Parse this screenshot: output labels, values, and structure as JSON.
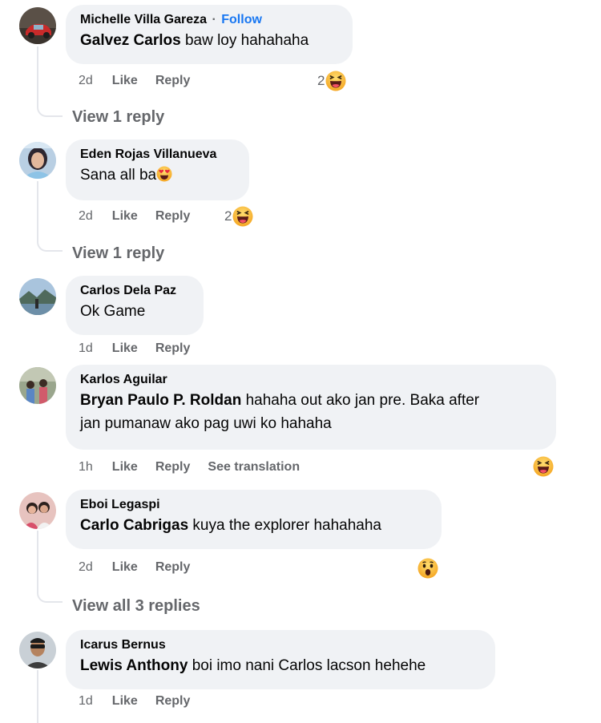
{
  "comments": [
    {
      "author": "Michelle Villa Gareza",
      "follow_label": "Follow",
      "separator": "·",
      "mention": "Galvez Carlos",
      "text": " baw loy hahahaha",
      "time": "2d",
      "like": "Like",
      "reply": "Reply",
      "reaction_count": "2",
      "reaction_icon": "laughing-emoji-icon",
      "view_replies": "View 1 reply"
    },
    {
      "author": "Eden Rojas Villanueva",
      "text": "Sana all ba",
      "inline_emoji": "heart-eyes-emoji-icon",
      "time": "2d",
      "like": "Like",
      "reply": "Reply",
      "reaction_count": "2",
      "reaction_icon": "laughing-emoji-icon",
      "view_replies": "View 1 reply"
    },
    {
      "author": "Carlos Dela Paz",
      "text": "Ok Game",
      "time": "1d",
      "like": "Like",
      "reply": "Reply"
    },
    {
      "author": "Karlos Aguilar",
      "mention": "Bryan Paulo P. Roldan",
      "text_line1": " hahaha out ako jan pre. Baka after",
      "text_line2": "jan pumanaw ako pag uwi ko hahaha",
      "time": "1h",
      "like": "Like",
      "reply": "Reply",
      "see_translation": "See translation",
      "reaction_icon": "laughing-emoji-icon"
    },
    {
      "author": "Eboi Legaspi",
      "mention": "Carlo Cabrigas",
      "text": " kuya the explorer hahahaha",
      "time": "2d",
      "like": "Like",
      "reply": "Reply",
      "reaction_icon": "wow-emoji-icon",
      "view_replies": "View all 3 replies"
    },
    {
      "author": "Icarus Bernus",
      "mention": "Lewis Anthony",
      "text": " boi imo nani Carlos lacson hehehe",
      "time": "1d",
      "like": "Like",
      "reply": "Reply"
    }
  ],
  "colors": {
    "bubble": "#f0f2f5",
    "secondary_text": "#65676b",
    "link_blue": "#1877f2",
    "thread_line": "#e4e6eb",
    "emoji_yellow": "#f7b125"
  }
}
